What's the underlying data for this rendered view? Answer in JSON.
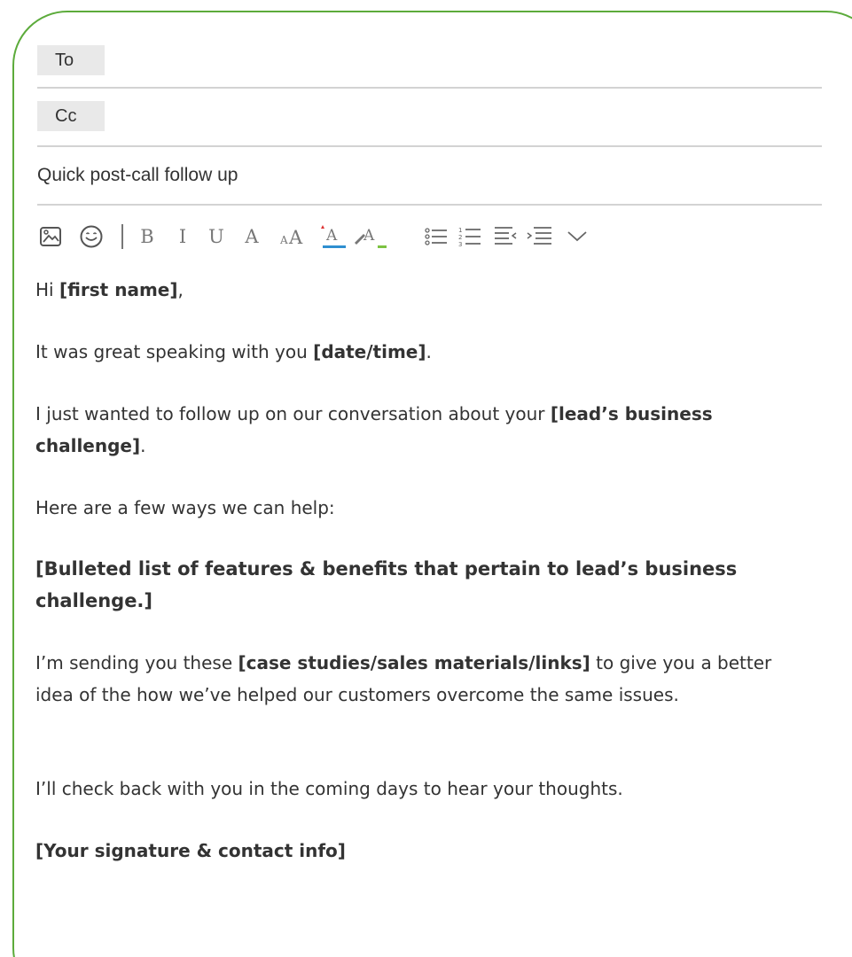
{
  "compose": {
    "to_label": "To",
    "cc_label": "Cc",
    "subject": "Quick post-call follow up"
  },
  "toolbar": {
    "items": [
      {
        "icon": "insert-image-icon"
      },
      {
        "icon": "emoji-icon"
      },
      {
        "icon": "bold-icon",
        "label": "B"
      },
      {
        "icon": "italic-icon",
        "label": "I"
      },
      {
        "icon": "underline-icon",
        "label": "U"
      },
      {
        "icon": "font-icon",
        "label": "A"
      },
      {
        "icon": "font-size-icon",
        "label": "AA"
      },
      {
        "icon": "text-color-icon",
        "label": "A",
        "color": "#2f8fd0"
      },
      {
        "icon": "highlight-icon",
        "label": "A",
        "color": "#7cc242"
      },
      {
        "icon": "bulleted-list-icon"
      },
      {
        "icon": "numbered-list-icon"
      },
      {
        "icon": "decrease-indent-icon"
      },
      {
        "icon": "increase-indent-icon"
      },
      {
        "icon": "more-chevron-icon"
      }
    ]
  },
  "email": {
    "p1": {
      "t1": "Hi ",
      "b1": "[first name]",
      "t2": ","
    },
    "p2": {
      "t1": "It was great speaking with you ",
      "b1": "[date/time]",
      "t2": "."
    },
    "p3": {
      "t1": "I just wanted to follow up on our conversation about your ",
      "b1": "[lead’s business challenge]",
      "t2": "."
    },
    "p4": {
      "t1": "Here are a few ways we can help:"
    },
    "p5": {
      "b1": "[Bulleted list of features & benefits that pertain to lead’s business challenge.]"
    },
    "p6": {
      "t1": "I’m sending you these ",
      "b1": "[case studies/sales materials/links]",
      "t2": " to give you a better idea of the how we’ve helped our customers overcome the same issues."
    },
    "p7": {
      "t1": "I’ll check back with you in the coming days to hear your thoughts."
    },
    "p8": {
      "b1": "[Your signature & contact info]"
    }
  },
  "colors": {
    "border": "#5cab3b",
    "text_color_underline": "#2f8fd0",
    "highlight_underline": "#7cc242",
    "divider": "#d3d3d3",
    "chip_bg": "#e9e9e9"
  }
}
